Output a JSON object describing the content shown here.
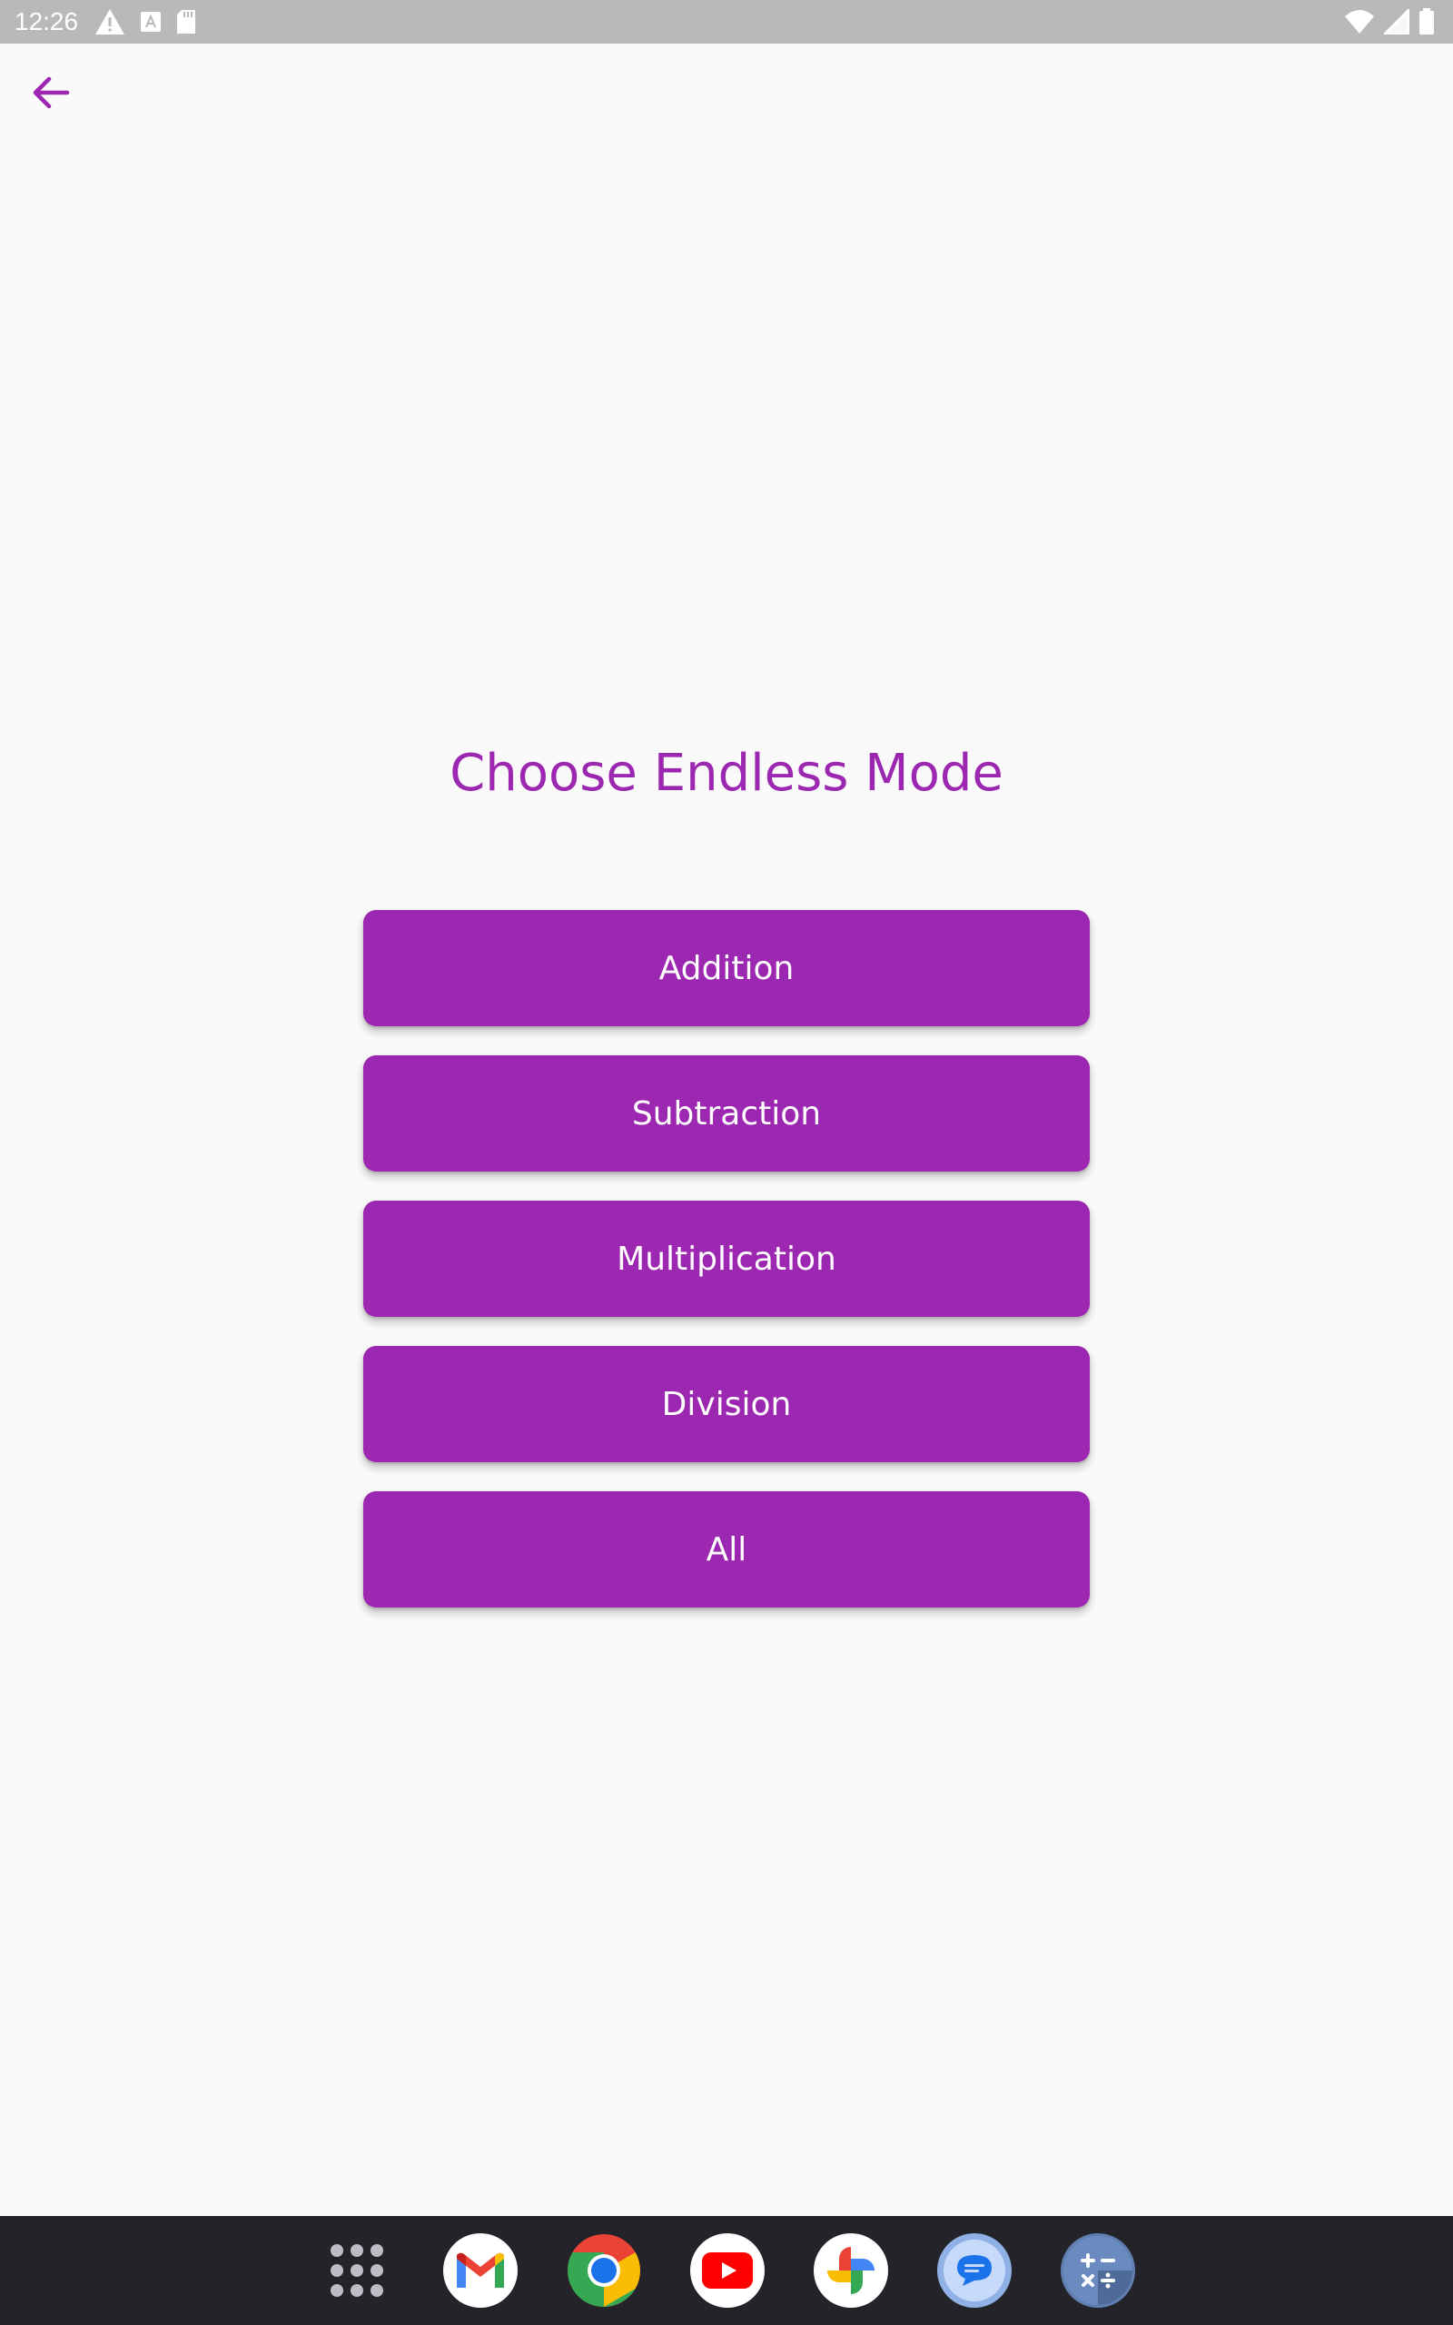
{
  "status_bar": {
    "time": "12:26",
    "left_icons": [
      "alert-icon",
      "a-notification-icon",
      "sd-card-icon"
    ],
    "right_icons": [
      "wifi-icon",
      "signal-icon",
      "battery-icon"
    ]
  },
  "header": {
    "back_icon": "arrow-left-icon"
  },
  "main": {
    "title": "Choose Endless Mode",
    "buttons": [
      {
        "label": "Addition"
      },
      {
        "label": "Subtraction"
      },
      {
        "label": "Multiplication"
      },
      {
        "label": "Division"
      },
      {
        "label": "All"
      }
    ]
  },
  "dock": {
    "apps": [
      "app-drawer-icon",
      "gmail-icon",
      "chrome-icon",
      "youtube-icon",
      "photos-icon",
      "messages-icon",
      "calculator-icon"
    ]
  },
  "colors": {
    "accent": "#9c27b0",
    "background": "#fafafa",
    "status_bar": "#b9b9b9",
    "dock": "#24232a"
  }
}
